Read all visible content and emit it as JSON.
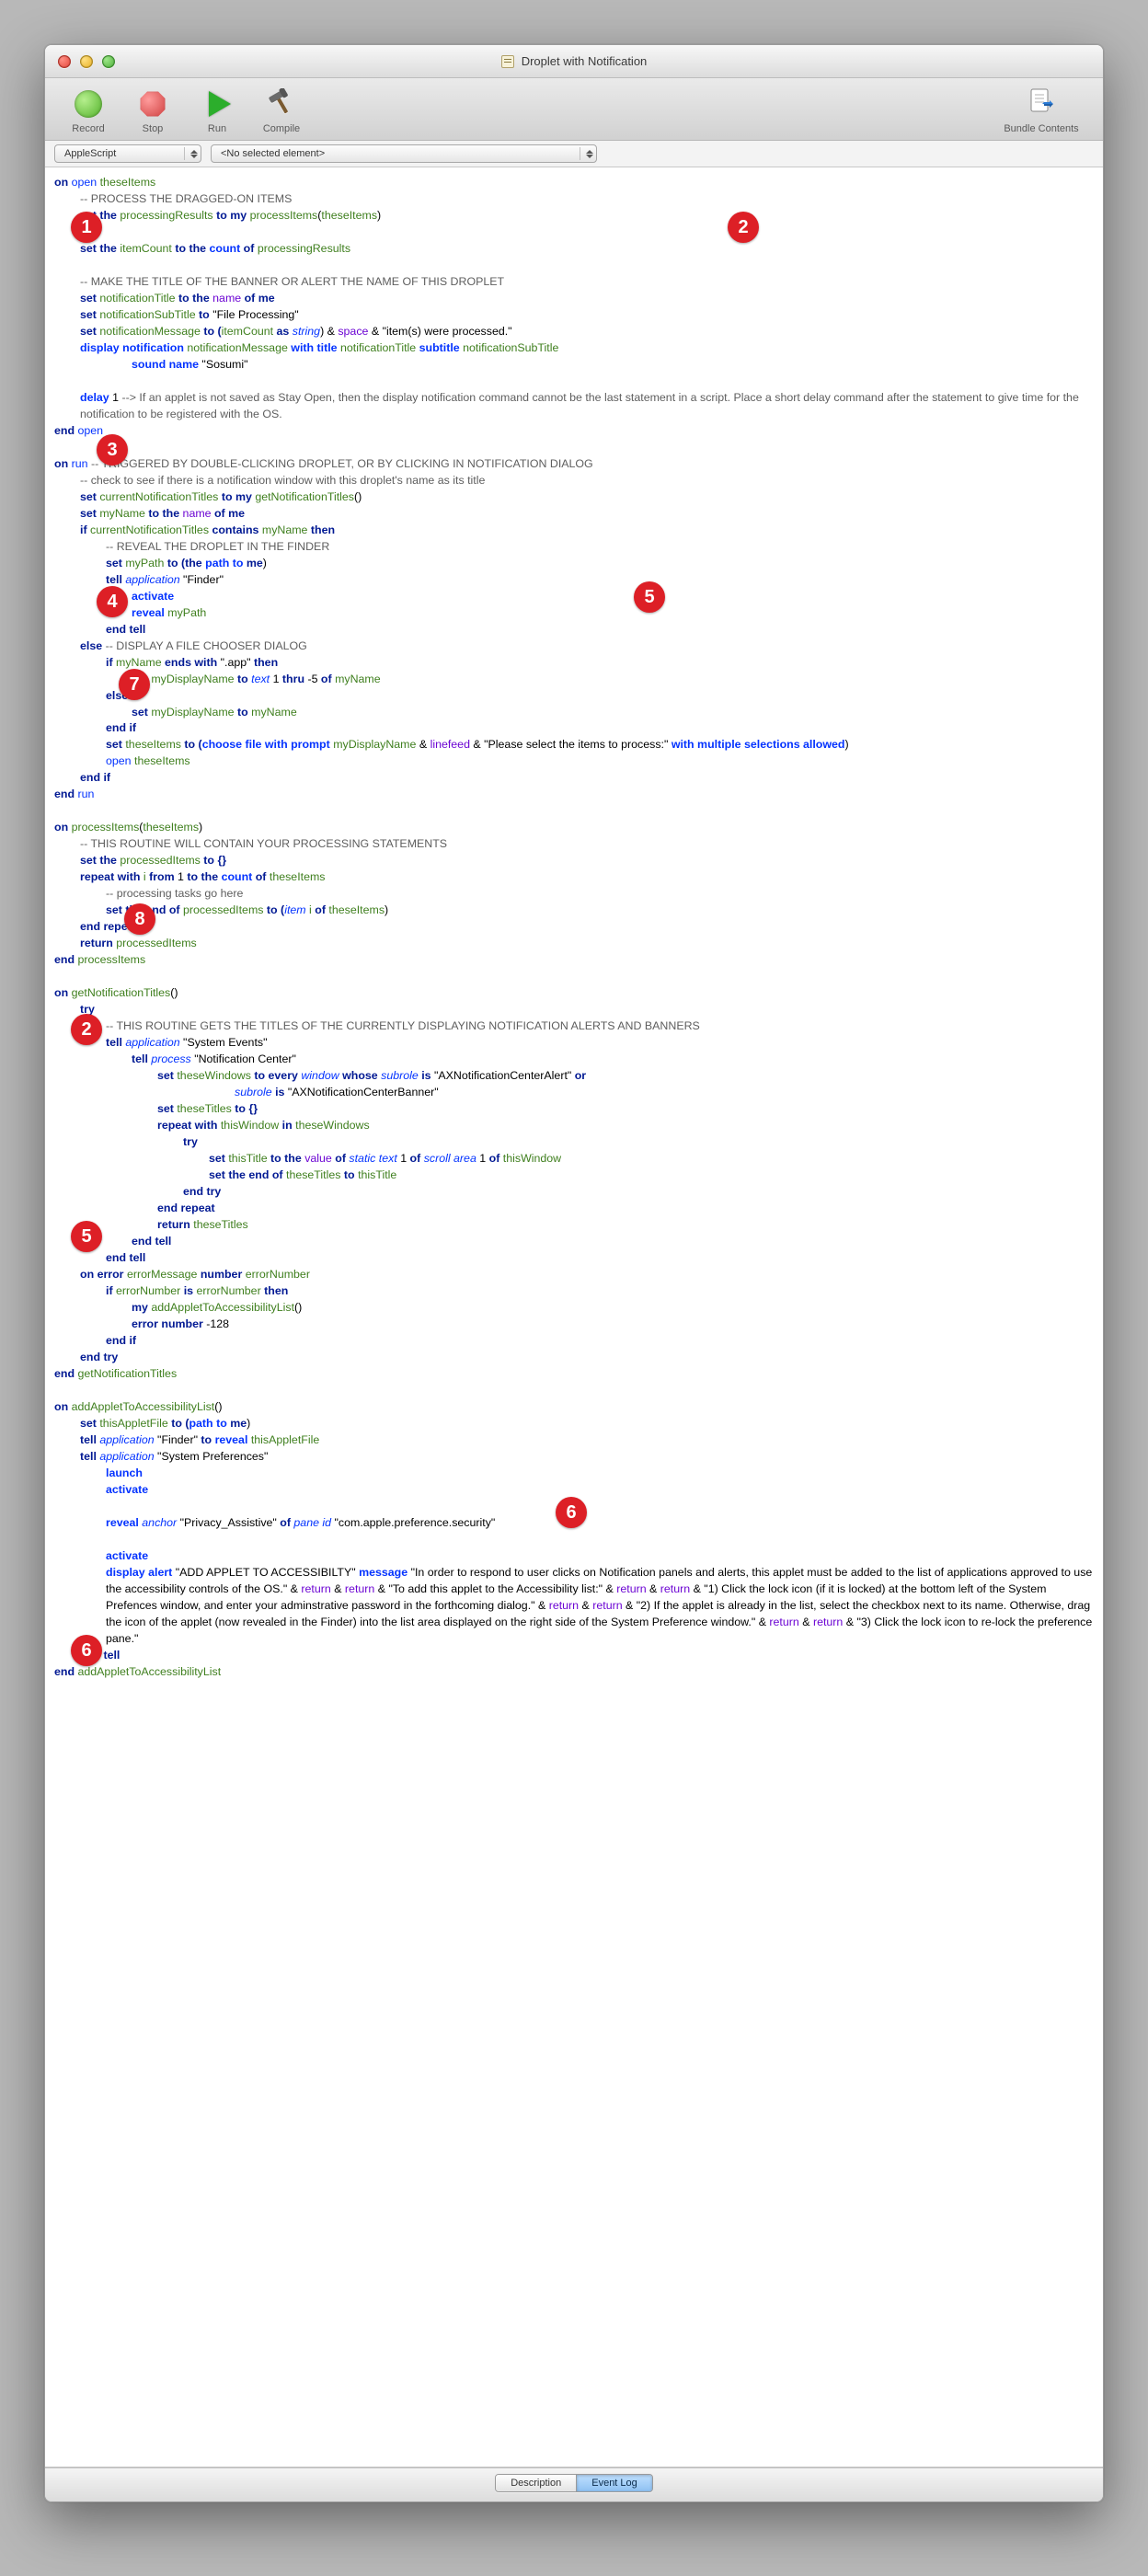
{
  "window": {
    "title": "Droplet with Notification"
  },
  "toolbar": {
    "record": "Record",
    "stop": "Stop",
    "run": "Run",
    "compile": "Compile",
    "bundle": "Bundle Contents"
  },
  "navbar": {
    "lang": "AppleScript",
    "elem": "<No selected element>"
  },
  "callouts": {
    "c1": "1",
    "c2a": "2",
    "c3": "3",
    "c4": "4",
    "c5a": "5",
    "c7": "7",
    "c8": "8",
    "c2b": "2",
    "c5b": "5",
    "c6a": "6",
    "c6b": "6"
  },
  "code": {
    "l01a": "on ",
    "l01b": "open ",
    "l01c": "theseItems",
    "l02": "-- PROCESS THE DRAGGED-ON ITEMS",
    "l03a": "set the ",
    "l03b": "processingResults",
    "l03c": " to my ",
    "l03d": "processItems",
    "l03e": "(",
    "l03f": "theseItems",
    "l03g": ")",
    "l04a": "set the ",
    "l04b": "itemCount",
    "l04c": " to the ",
    "l04d": "count",
    "l04e": " of ",
    "l04f": "processingResults",
    "l05": "-- MAKE THE TITLE OF THE BANNER OR ALERT THE NAME OF THIS DROPLET",
    "l06a": "set ",
    "l06b": "notificationTitle",
    "l06c": " to the ",
    "l06d": "name",
    "l06e": " of ",
    "l06f": "me",
    "l07a": "set ",
    "l07b": "notificationSubTitle",
    "l07c": " to ",
    "l07d": "\"File Processing\"",
    "l08a": "set ",
    "l08b": "notificationMessage",
    "l08c": " to (",
    "l08d": "itemCount",
    "l08e": " as ",
    "l08f": "string",
    "l08g": ") & ",
    "l08h": "space",
    "l08i": " & \"item(s) were processed.\"",
    "l09a": "display notification ",
    "l09b": "notificationMessage",
    "l09c": " with title ",
    "l09d": "notificationTitle",
    "l09e": " subtitle ",
    "l09f": "notificationSubTitle",
    "l09g": "sound name ",
    "l09h": "\"Sosumi\"",
    "l10a": "delay ",
    "l10b": "1",
    "l10c": " --> If an applet is not saved as Stay Open, then the display notification command cannot be the last statement in a script. Place a short delay command after the statement to give time for the notification to be registered with the OS.",
    "l11a": "end ",
    "l11b": "open",
    "l12a": "on ",
    "l12b": "run ",
    "l12c": "-- TRIGGERED BY DOUBLE-CLICKING DROPLET, OR BY CLICKING IN NOTIFICATION DIALOG",
    "l13": "-- check to see if there is a notification window with this droplet's name as its title",
    "l14a": "set ",
    "l14b": "currentNotificationTitles",
    "l14c": " to my ",
    "l14d": "getNotificationTitles",
    "l14e": "()",
    "l15a": "set ",
    "l15b": "myName",
    "l15c": " to the ",
    "l15d": "name",
    "l15e": " of ",
    "l15f": "me",
    "l16a": "if ",
    "l16b": "currentNotificationTitles",
    "l16c": " contains ",
    "l16d": "myName",
    "l16e": " then",
    "l17": "-- REVEAL THE DROPLET IN THE FINDER",
    "l18a": "set ",
    "l18b": "myPath",
    "l18c": " to (",
    "l18d": "the ",
    "l18e": "path to ",
    "l18f": "me",
    "l18g": ")",
    "l19a": "tell ",
    "l19b": "application ",
    "l19c": "\"Finder\"",
    "l20": "activate",
    "l21a": "reveal ",
    "l21b": "myPath",
    "l22": "end tell",
    "l23a": "else ",
    "l23b": "-- DISPLAY A FILE CHOOSER DIALOG",
    "l24a": "if ",
    "l24b": "myName",
    "l24c": " ends with ",
    "l24d": "\".app\" ",
    "l24e": "then",
    "l25a": "set ",
    "l25b": "myDisplayName",
    "l25c": " to ",
    "l25d": "text ",
    "l25e": "1 ",
    "l25f": "thru ",
    "l25g": "-5 ",
    "l25h": "of ",
    "l25i": "myName",
    "l26": "else",
    "l27a": "set ",
    "l27b": "myDisplayName",
    "l27c": " to ",
    "l27d": "myName",
    "l28": "end if",
    "l29a": "set ",
    "l29b": "theseItems",
    "l29c": " to (",
    "l29d": "choose file ",
    "l29e": "with prompt ",
    "l29f": "myDisplayName",
    "l29g": " & ",
    "l29h": "linefeed",
    "l29i": " & \"Please select the items to process:\" ",
    "l29j": "with ",
    "l29k": "multiple selections allowed",
    "l29l": ")",
    "l30a": "open ",
    "l30b": "theseItems",
    "l31": "end if",
    "l32a": "end ",
    "l32b": "run",
    "l33a": "on ",
    "l33b": "processItems",
    "l33c": "(",
    "l33d": "theseItems",
    "l33e": ")",
    "l34": "-- THIS ROUTINE WILL CONTAIN YOUR PROCESSING STATEMENTS",
    "l35a": "set the ",
    "l35b": "processedItems",
    "l35c": " to {}",
    "l36a": "repeat with ",
    "l36b": "i",
    "l36c": " from ",
    "l36d": "1",
    "l36e": " to the ",
    "l36f": "count",
    "l36g": " of ",
    "l36h": "theseItems",
    "l37": "-- processing tasks go here",
    "l38a": "set the end of ",
    "l38b": "processedItems",
    "l38c": " to (",
    "l38d": "item ",
    "l38e": "i",
    "l38f": " of ",
    "l38g": "theseItems",
    "l38h": ")",
    "l39": "end repeat",
    "l40a": "return ",
    "l40b": "processedItems",
    "l41a": "end ",
    "l41b": "processItems",
    "l42a": "on ",
    "l42b": "getNotificationTitles",
    "l42c": "()",
    "l43": "try",
    "l44": "-- THIS ROUTINE GETS THE TITLES OF THE CURRENTLY DISPLAYING NOTIFICATION ALERTS AND BANNERS",
    "l45a": "tell ",
    "l45b": "application ",
    "l45c": "\"System Events\"",
    "l46a": "tell ",
    "l46b": "process ",
    "l46c": "\"Notification Center\"",
    "l47a": "set ",
    "l47b": "theseWindows",
    "l47c": " to every ",
    "l47d": "window ",
    "l47e": "whose ",
    "l47f": "subrole ",
    "l47g": "is ",
    "l47h": "\"AXNotificationCenterAlert\" ",
    "l47i": "or",
    "l47j": "subrole ",
    "l47k": "is ",
    "l47l": "\"AXNotificationCenterBanner\"",
    "l48a": "set ",
    "l48b": "theseTitles",
    "l48c": " to {}",
    "l49a": "repeat with ",
    "l49b": "thisWindow",
    "l49c": " in ",
    "l49d": "theseWindows",
    "l50": "try",
    "l51a": "set ",
    "l51b": "thisTitle",
    "l51c": " to the ",
    "l51d": "value ",
    "l51e": "of ",
    "l51f": "static text ",
    "l51g": "1 ",
    "l51h": "of ",
    "l51i": "scroll area ",
    "l51j": "1 ",
    "l51k": "of ",
    "l51l": "thisWindow",
    "l52a": "set the end of ",
    "l52b": "theseTitles",
    "l52c": " to ",
    "l52d": "thisTitle",
    "l53": "end try",
    "l54": "end repeat",
    "l55a": "return ",
    "l55b": "theseTitles",
    "l56": "end tell",
    "l57": "end tell",
    "l58a": "on error ",
    "l58b": "errorMessage",
    "l58c": " number ",
    "l58d": "errorNumber",
    "l59a": "if ",
    "l59b": "errorNumber",
    "l59c": " is ",
    "l59d": "errorNumber",
    "l59e": " then",
    "l60a": "my ",
    "l60b": "addAppletToAccessibilityList",
    "l60c": "()",
    "l61a": "error ",
    "l61b": "number ",
    "l61c": "-128",
    "l62": "end if",
    "l63": "end try",
    "l64a": "end ",
    "l64b": "getNotificationTitles",
    "l65a": "on ",
    "l65b": "addAppletToAccessibilityList",
    "l65c": "()",
    "l66a": "set ",
    "l66b": "thisAppletFile",
    "l66c": " to (",
    "l66d": "path to ",
    "l66e": "me",
    "l66f": ")",
    "l67a": "tell ",
    "l67b": "application ",
    "l67c": "\"Finder\" ",
    "l67d": "to ",
    "l67e": "reveal ",
    "l67f": "thisAppletFile",
    "l68a": "tell ",
    "l68b": "application ",
    "l68c": "\"System Preferences\"",
    "l69": "launch",
    "l70": "activate",
    "l71a": "reveal ",
    "l71b": "anchor ",
    "l71c": "\"Privacy_Assistive\" ",
    "l71d": "of ",
    "l71e": "pane ",
    "l71f": "id ",
    "l71g": "\"com.apple.preference.security\"",
    "l72": "activate",
    "l73a": "display alert ",
    "l73b": "\"ADD APPLET TO ACCESSIBILTY\" ",
    "l73c": "message ",
    "l73d": "\"In order to respond to user clicks on Notification panels and alerts, this applet must be added to the list of applications approved to use the accessibility controls of the OS.\" & ",
    "l73e": "return",
    "l73f": " & ",
    "l73g": "return",
    "l73h": " & \"To add this applet to the Accessibility list:\" & ",
    "l73i": "return",
    "l73j": " & ",
    "l73k": "return",
    "l73l": " & \"1) Click the lock icon (if it is locked) at the bottom left of the System Prefences window, and enter your adminstrative password in the forthcoming dialog.\" & ",
    "l73m": "return",
    "l73n": " & ",
    "l73o": "return",
    "l73p": " & \"2) If the applet is already in the list, select the checkbox next to its name. Otherwise, drag the icon of the applet (now revealed in the Finder) into the list area displayed on the right side of the System Preference window.\" & ",
    "l73q": "return",
    "l73r": " & ",
    "l73s": "return",
    "l73t": " & \"3) Click the lock icon to re-lock the preference pane.\"",
    "l74": "end tell",
    "l75a": "end ",
    "l75b": "addAppletToAccessibilityList"
  },
  "bottombar": {
    "desc": "Description",
    "log": "Event Log"
  }
}
